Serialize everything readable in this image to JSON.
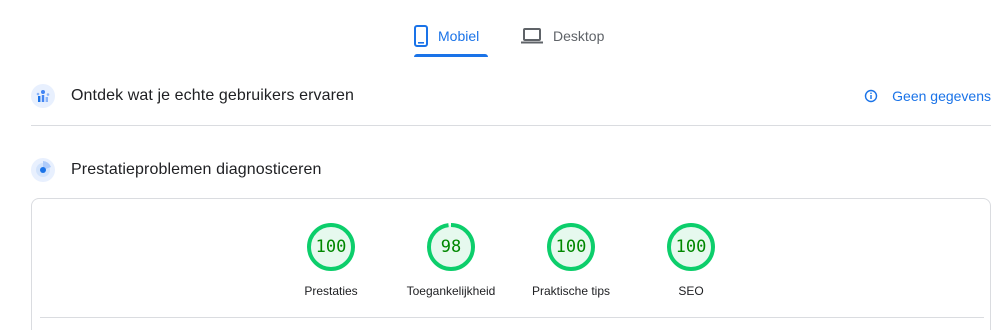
{
  "tabs": {
    "mobile_label": "Mobiel",
    "desktop_label": "Desktop",
    "active": "mobile",
    "mobile_icon": "phone-icon",
    "desktop_icon": "laptop-icon"
  },
  "crux": {
    "title": "Ontdek wat je echte gebruikers ervaren",
    "icon": "users-chart-icon",
    "no_data_label": "Geen gegevens",
    "no_data_icon": "info-icon"
  },
  "lab": {
    "title": "Prestatieproblemen diagnosticeren",
    "icon": "radar-icon"
  },
  "scores": [
    {
      "label": "Prestaties",
      "value": "100"
    },
    {
      "label": "Toegankelijkheid",
      "value": "98"
    },
    {
      "label": "Praktische tips",
      "value": "100"
    },
    {
      "label": "SEO",
      "value": "100"
    }
  ],
  "colors": {
    "accent": "#1a73e8",
    "pass": "#0cce6b",
    "pass_text": "#008800",
    "pass_fill": "#e6f9ee",
    "divider": "#dadce0"
  }
}
